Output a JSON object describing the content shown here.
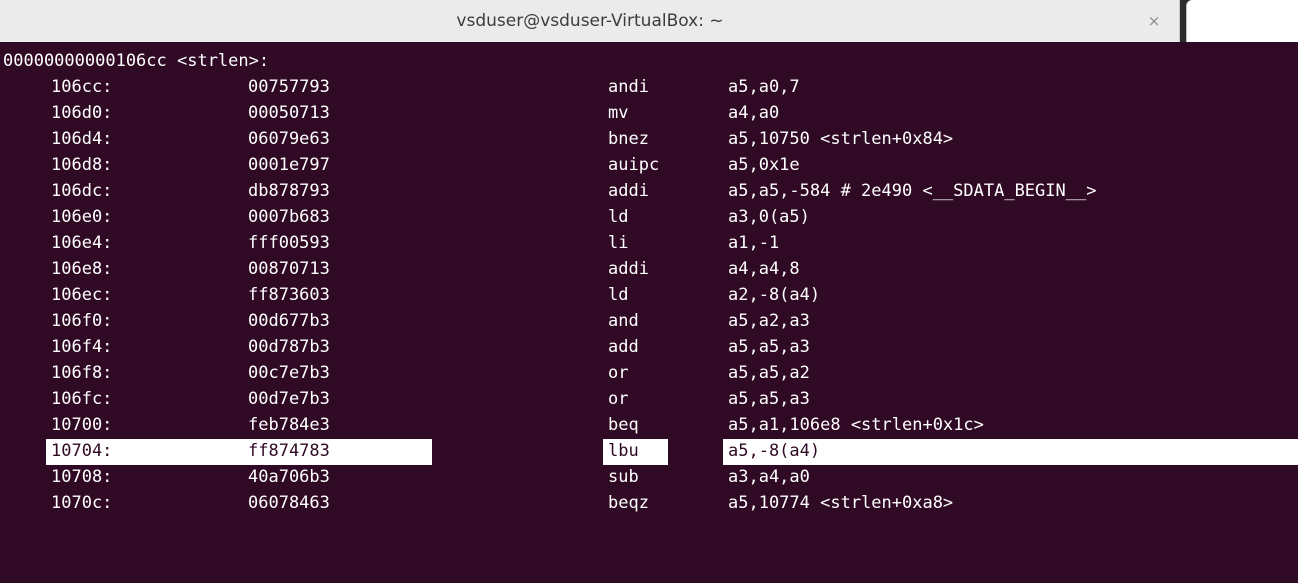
{
  "window": {
    "title": "vsduser@vsduser-VirtualBox: ~",
    "close_glyph": "×"
  },
  "terminal": {
    "header": "00000000000106cc <strlen>:",
    "selected_index": 15,
    "rows": [
      {
        "addr": "106cc:",
        "hex": "00757793",
        "mnemonic": "andi",
        "operands": "a5,a0,7"
      },
      {
        "addr": "106d0:",
        "hex": "00050713",
        "mnemonic": "mv",
        "operands": "a4,a0"
      },
      {
        "addr": "106d4:",
        "hex": "06079e63",
        "mnemonic": "bnez",
        "operands": "a5,10750 <strlen+0x84>"
      },
      {
        "addr": "106d8:",
        "hex": "0001e797",
        "mnemonic": "auipc",
        "operands": "a5,0x1e"
      },
      {
        "addr": "106dc:",
        "hex": "db878793",
        "mnemonic": "addi",
        "operands": "a5,a5,-584 # 2e490 <__SDATA_BEGIN__>"
      },
      {
        "addr": "106e0:",
        "hex": "0007b683",
        "mnemonic": "ld",
        "operands": "a3,0(a5)"
      },
      {
        "addr": "106e4:",
        "hex": "fff00593",
        "mnemonic": "li",
        "operands": "a1,-1"
      },
      {
        "addr": "106e8:",
        "hex": "00870713",
        "mnemonic": "addi",
        "operands": "a4,a4,8"
      },
      {
        "addr": "106ec:",
        "hex": "ff873603",
        "mnemonic": "ld",
        "operands": "a2,-8(a4)"
      },
      {
        "addr": "106f0:",
        "hex": "00d677b3",
        "mnemonic": "and",
        "operands": "a5,a2,a3"
      },
      {
        "addr": "106f4:",
        "hex": "00d787b3",
        "mnemonic": "add",
        "operands": "a5,a5,a3"
      },
      {
        "addr": "106f8:",
        "hex": "00c7e7b3",
        "mnemonic": "or",
        "operands": "a5,a5,a2"
      },
      {
        "addr": "106fc:",
        "hex": "00d7e7b3",
        "mnemonic": "or",
        "operands": "a5,a5,a3"
      },
      {
        "addr": "10700:",
        "hex": "feb784e3",
        "mnemonic": "beq",
        "operands": "a5,a1,106e8 <strlen+0x1c>"
      },
      {
        "addr": "10704:",
        "hex": "ff874783",
        "mnemonic": "lbu",
        "operands": "a5,-8(a4)"
      },
      {
        "addr": "10708:",
        "hex": "40a706b3",
        "mnemonic": "sub",
        "operands": "a3,a4,a0"
      },
      {
        "addr": "1070c:",
        "hex": "06078463",
        "mnemonic": "beqz",
        "operands": "a5,10774 <strlen+0xa8>"
      }
    ]
  },
  "colors": {
    "terminal_bg": "#300a24",
    "terminal_fg": "#ffffff",
    "titlebar_bg": "#ebebeb",
    "selection_bg": "#ffffff"
  }
}
